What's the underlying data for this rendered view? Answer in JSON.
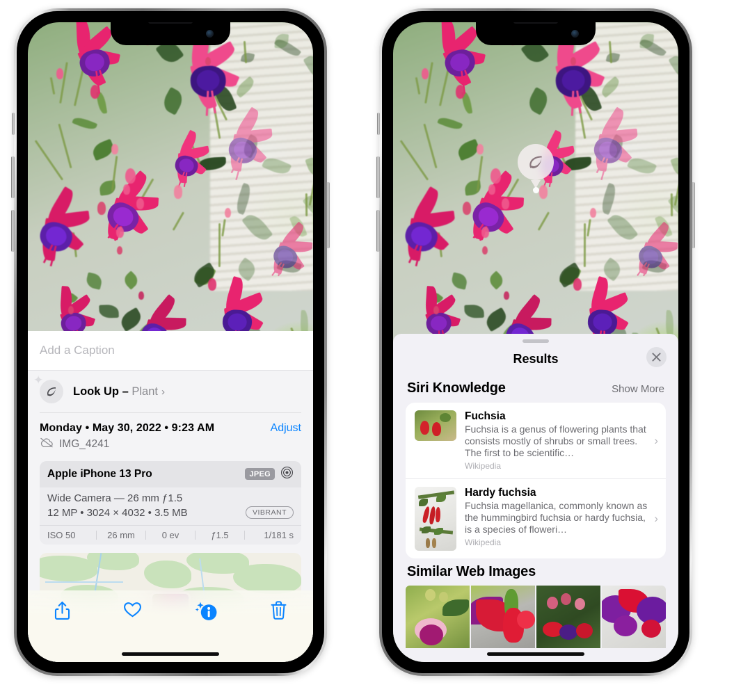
{
  "left_phone": {
    "caption": {
      "placeholder": "Add a Caption",
      "value": ""
    },
    "lookup_row": {
      "icon": "leaf-icon",
      "sparkle_icon": "sparkle-icon",
      "label": "Look Up",
      "separator": " – ",
      "subject": "Plant",
      "chevron": "›"
    },
    "date_row": {
      "date": "Monday • May 30, 2022 • 9:23 AM",
      "adjust_label": "Adjust"
    },
    "file_row": {
      "icon": "cloud-slash-icon",
      "filename": "IMG_4241"
    },
    "camera_card": {
      "device": "Apple iPhone 13 Pro",
      "format_badge": "JPEG",
      "aperture_icon": "aperture-icon",
      "lens_line": "Wide Camera — 26 mm ƒ1.5",
      "spec_line": "12 MP • 3024 × 4032 • 3.5 MB",
      "style_badge": "VIBRANT",
      "exif": [
        "ISO 50",
        "26 mm",
        "0 ev",
        "ƒ1.5",
        "1/181 s"
      ]
    },
    "toolbar": [
      {
        "name": "share-icon",
        "label": "Share"
      },
      {
        "name": "heart-icon",
        "label": "Favorite"
      },
      {
        "name": "info-sparkle-icon",
        "label": "Info"
      },
      {
        "name": "trash-icon",
        "label": "Delete"
      }
    ]
  },
  "right_phone": {
    "lookup_badge": {
      "icon": "leaf-icon"
    },
    "sheet": {
      "title": "Results",
      "close_icon": "close-icon"
    },
    "siri_knowledge": {
      "title": "Siri Knowledge",
      "show_more": "Show More",
      "items": [
        {
          "title": "Fuchsia",
          "description": "Fuchsia is a genus of flowering plants that consists mostly of shrubs or small trees. The first to be scientific…",
          "source": "Wikipedia",
          "chevron": "›"
        },
        {
          "title": "Hardy fuchsia",
          "description": "Fuchsia magellanica, commonly known as the hummingbird fuchsia or hardy fuchsia, is a species of floweri…",
          "source": "Wikipedia",
          "chevron": "›"
        }
      ]
    },
    "similar_web_images": {
      "title": "Similar Web Images",
      "thumbnails": [
        "web-image-1",
        "web-image-2",
        "web-image-3",
        "web-image-4"
      ]
    }
  },
  "colors": {
    "accent_blue": "#0a84ff",
    "sheet_gray": "#f2f1f6",
    "card_white": "#ffffff",
    "secondary_text": "#6c6c71",
    "tertiary_text": "#aeaeb3"
  }
}
